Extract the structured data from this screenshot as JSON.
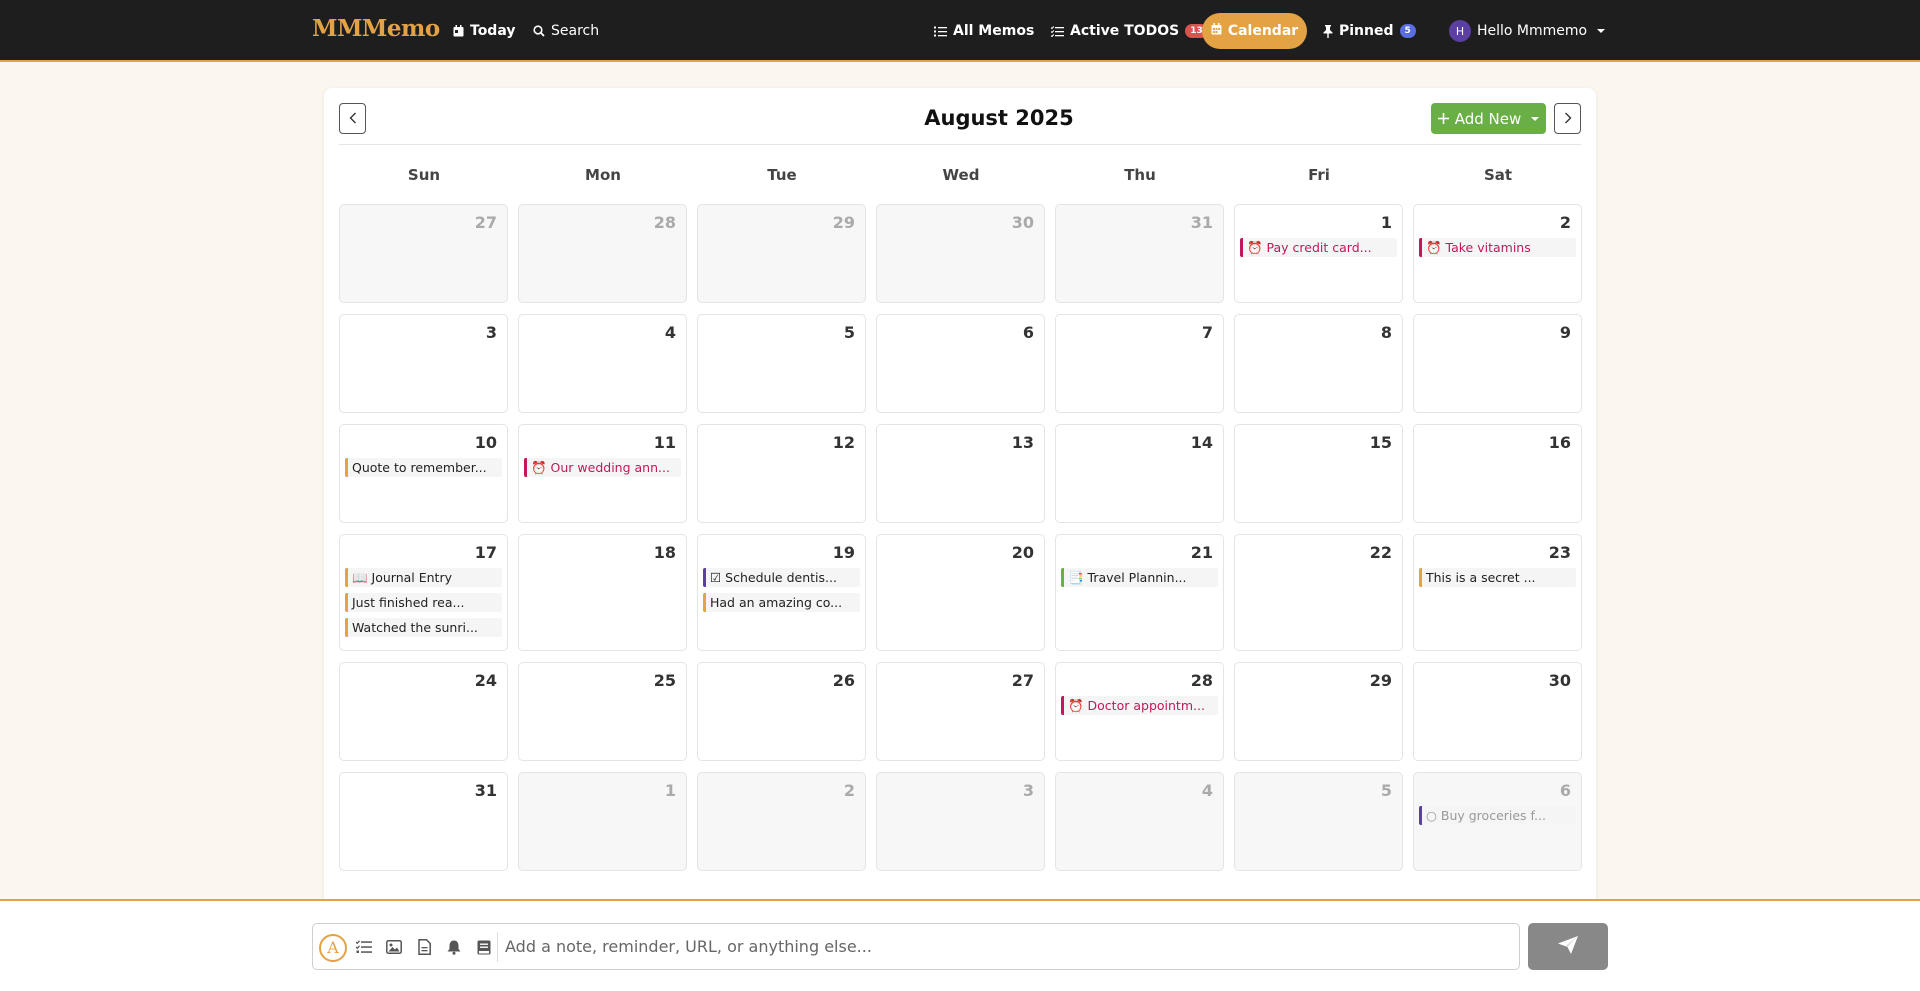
{
  "app": {
    "brand": "MMMemo"
  },
  "nav": {
    "today": "Today",
    "search": "Search",
    "all_memos": "All Memos",
    "active_todos": "Active TODOS",
    "active_todos_count": "13",
    "calendar": "Calendar",
    "pinned": "Pinned",
    "pinned_count": "5",
    "user_greeting": "Hello Mmmemo",
    "avatar_initial": "H"
  },
  "calendar": {
    "month_title": "August 2025",
    "add_new": "Add New",
    "weekdays": [
      "Sun",
      "Mon",
      "Tue",
      "Wed",
      "Thu",
      "Fri",
      "Sat"
    ],
    "weeks": [
      [
        {
          "day": "27",
          "other": true,
          "events": []
        },
        {
          "day": "28",
          "other": true,
          "events": []
        },
        {
          "day": "29",
          "other": true,
          "events": []
        },
        {
          "day": "30",
          "other": true,
          "events": []
        },
        {
          "day": "31",
          "other": true,
          "events": []
        },
        {
          "day": "1",
          "other": false,
          "events": [
            {
              "text": "⏰ Pay credit card...",
              "kind": "reminder"
            }
          ]
        },
        {
          "day": "2",
          "other": false,
          "events": [
            {
              "text": "⏰ Take vitamins",
              "kind": "reminder"
            }
          ]
        }
      ],
      [
        {
          "day": "3",
          "other": false,
          "events": []
        },
        {
          "day": "4",
          "other": false,
          "events": []
        },
        {
          "day": "5",
          "other": false,
          "events": []
        },
        {
          "day": "6",
          "other": false,
          "events": []
        },
        {
          "day": "7",
          "other": false,
          "events": []
        },
        {
          "day": "8",
          "other": false,
          "events": []
        },
        {
          "day": "9",
          "other": false,
          "events": []
        }
      ],
      [
        {
          "day": "10",
          "other": false,
          "events": [
            {
              "text": "Quote to remember...",
              "kind": "journal"
            }
          ]
        },
        {
          "day": "11",
          "other": false,
          "events": [
            {
              "text": "⏰ Our wedding ann...",
              "kind": "reminder"
            }
          ]
        },
        {
          "day": "12",
          "other": false,
          "events": []
        },
        {
          "day": "13",
          "other": false,
          "events": []
        },
        {
          "day": "14",
          "other": false,
          "events": []
        },
        {
          "day": "15",
          "other": false,
          "events": []
        },
        {
          "day": "16",
          "other": false,
          "events": []
        }
      ],
      [
        {
          "day": "17",
          "other": false,
          "events": [
            {
              "text": "📖 Journal Entry",
              "kind": "journal"
            },
            {
              "text": "Just finished rea...",
              "kind": "journal"
            },
            {
              "text": "Watched the sunri...",
              "kind": "journal"
            }
          ]
        },
        {
          "day": "18",
          "other": false,
          "events": []
        },
        {
          "day": "19",
          "other": false,
          "events": [
            {
              "text": "☑ Schedule dentis...",
              "kind": "todo"
            },
            {
              "text": "Had an amazing co...",
              "kind": "journal"
            }
          ]
        },
        {
          "day": "20",
          "other": false,
          "events": []
        },
        {
          "day": "21",
          "other": false,
          "events": [
            {
              "text": "📑 Travel Plannin...",
              "kind": "doc"
            }
          ]
        },
        {
          "day": "22",
          "other": false,
          "events": []
        },
        {
          "day": "23",
          "other": false,
          "events": [
            {
              "text": "This is a secret ...",
              "kind": "journal"
            }
          ]
        }
      ],
      [
        {
          "day": "24",
          "other": false,
          "events": []
        },
        {
          "day": "25",
          "other": false,
          "events": []
        },
        {
          "day": "26",
          "other": false,
          "events": []
        },
        {
          "day": "27",
          "other": false,
          "events": []
        },
        {
          "day": "28",
          "other": false,
          "events": [
            {
              "text": "⏰ Doctor appointm...",
              "kind": "reminder"
            }
          ]
        },
        {
          "day": "29",
          "other": false,
          "events": []
        },
        {
          "day": "30",
          "other": false,
          "events": []
        }
      ],
      [
        {
          "day": "31",
          "other": false,
          "events": []
        },
        {
          "day": "1",
          "other": true,
          "events": []
        },
        {
          "day": "2",
          "other": true,
          "events": []
        },
        {
          "day": "3",
          "other": true,
          "events": []
        },
        {
          "day": "4",
          "other": true,
          "events": []
        },
        {
          "day": "5",
          "other": true,
          "events": []
        },
        {
          "day": "6",
          "other": true,
          "events": [
            {
              "text": "○ Buy groceries f...",
              "kind": "todo"
            }
          ]
        }
      ]
    ]
  },
  "composer": {
    "placeholder": "Add a note, reminder, URL, or anything else..."
  },
  "colors": {
    "accent": "#e3a244",
    "nav_bg": "#1e1e1e",
    "add_new": "#6aaf45",
    "reminder": "#c2185b",
    "todo": "#5b3fa3"
  }
}
